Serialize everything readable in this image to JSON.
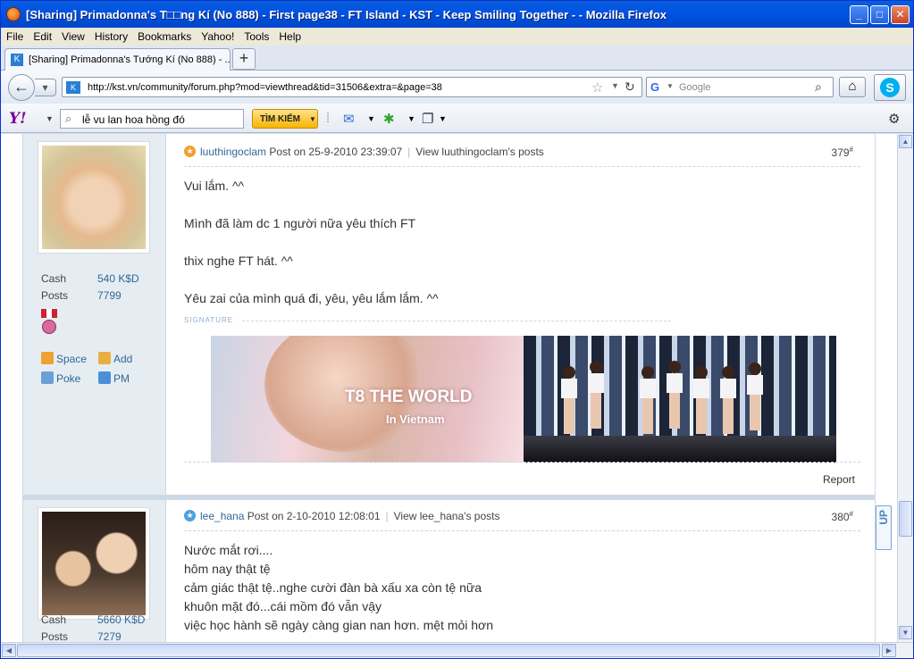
{
  "window": {
    "title": "[Sharing] Primadonna's T□□ng Kí (No 888) - First page38 - FT Island - KST - Keep Smiling Together - - Mozilla Firefox"
  },
  "menu": [
    "File",
    "Edit",
    "View",
    "History",
    "Bookmarks",
    "Yahoo!",
    "Tools",
    "Help"
  ],
  "tab": {
    "label": "[Sharing] Primadonna's Tướng Kí (No 888) - ..."
  },
  "nav": {
    "url": "http://kst.vn/community/forum.php?mod=viewthread&tid=31506&extra=&page=38",
    "search_placeholder": "Google"
  },
  "yahoo": {
    "search_value": "lễ vu lan hoa hồng đó",
    "search_button": "TÌM KIẾM"
  },
  "posts": [
    {
      "author": "luuthingoclam",
      "posted": "Post on 25-9-2010 23:39:07",
      "view_link": "View luuthingoclam's posts",
      "number": "379",
      "cash_label": "Cash",
      "cash_value": "540 K$D",
      "posts_label": "Posts",
      "posts_value": "7799",
      "links": [
        "Space",
        "Add",
        "Poke",
        "PM"
      ],
      "body": [
        "Vui lắm. ^^",
        "Mình đã làm dc 1 người nữa yêu thích FT",
        "thix nghe FT hát. ^^",
        "Yêu zai của mình quá đi, yêu, yêu lắm lắm. ^^"
      ],
      "signature_label": "SIGNATURE",
      "banner_text_1": "T8 THE WORLD",
      "banner_text_2": "In Vietnam",
      "report": "Report"
    },
    {
      "author": "lee_hana",
      "posted": "Post on 2-10-2010 12:08:01",
      "view_link": "View lee_hana's posts",
      "number": "380",
      "cash_label": "Cash",
      "cash_value": "5660 K$D",
      "posts_label": "Posts",
      "posts_value": "7279",
      "body": [
        "Nước mắt rơi....",
        "hôm nay thật tệ",
        "cảm giác thật tệ..nghe cười đàn bà xấu xa còn tệ nữa",
        "khuôn mặt đó...cái mồm đó vẫn vậy",
        "việc học hành sẽ ngày càng gian nan hơn. mệt mỏi hơn"
      ]
    }
  ],
  "up_button": "UP",
  "colors": {
    "link": "#336699",
    "sidebar": "#e5edf2",
    "titlebar": "#0153e6"
  }
}
